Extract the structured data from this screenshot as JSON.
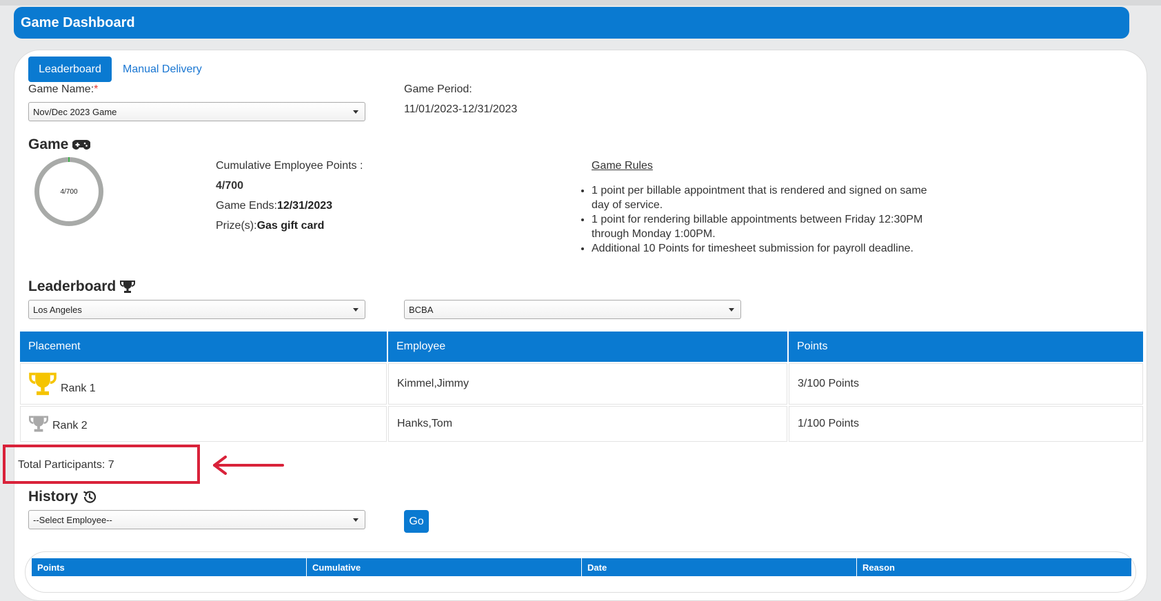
{
  "header": {
    "title": "Game Dashboard"
  },
  "tabs": [
    {
      "label": "Leaderboard",
      "active": true
    },
    {
      "label": "Manual Delivery",
      "active": false
    }
  ],
  "game_form": {
    "game_name_label": "Game Name:",
    "required_mark": "*",
    "game_name_value": "Nov/Dec 2023 Game",
    "game_period_label": "Game Period:",
    "game_period_value": "11/01/2023-12/31/2023"
  },
  "game_section": {
    "title": "Game",
    "ring_text": "4/700",
    "progress": {
      "current": 4,
      "total": 700
    },
    "cumulative_label": "Cumulative Employee Points :",
    "cumulative_value": "4/700",
    "ends_label": "Game Ends:",
    "ends_value": "12/31/2023",
    "prize_label": "Prize(s):",
    "prize_value": "Gas gift card",
    "rules_title": "Game Rules",
    "rules": [
      "1 point per billable appointment that is rendered and signed on same day of service.",
      "1 point for rendering billable appointments between Friday 12:30PM through Monday 1:00PM.",
      "Additional 10 Points for timesheet submission for payroll deadline."
    ]
  },
  "leaderboard": {
    "title": "Leaderboard",
    "location_filter": "Los Angeles",
    "role_filter": "BCBA",
    "columns": [
      "Placement",
      "Employee",
      "Points"
    ],
    "rows": [
      {
        "rank": "Rank 1",
        "employee": "Kimmel,Jimmy",
        "points": "3/100 Points",
        "trophy": "gold"
      },
      {
        "rank": "Rank 2",
        "employee": "Hanks,Tom",
        "points": "1/100 Points",
        "trophy": "silver"
      }
    ],
    "total_participants": "Total Participants: 7"
  },
  "history": {
    "title": "History",
    "employee_select": "--Select Employee--",
    "go_label": "Go",
    "columns": [
      "Points",
      "Cumulative",
      "Date",
      "Reason"
    ]
  },
  "colors": {
    "primary": "#0a7ad1",
    "annotation_red": "#d9223a",
    "gold_trophy": "#f5c400",
    "silver_trophy": "#a9a9a9",
    "ring_gray": "#a8aaa8",
    "ring_progress": "#3fb44a"
  }
}
